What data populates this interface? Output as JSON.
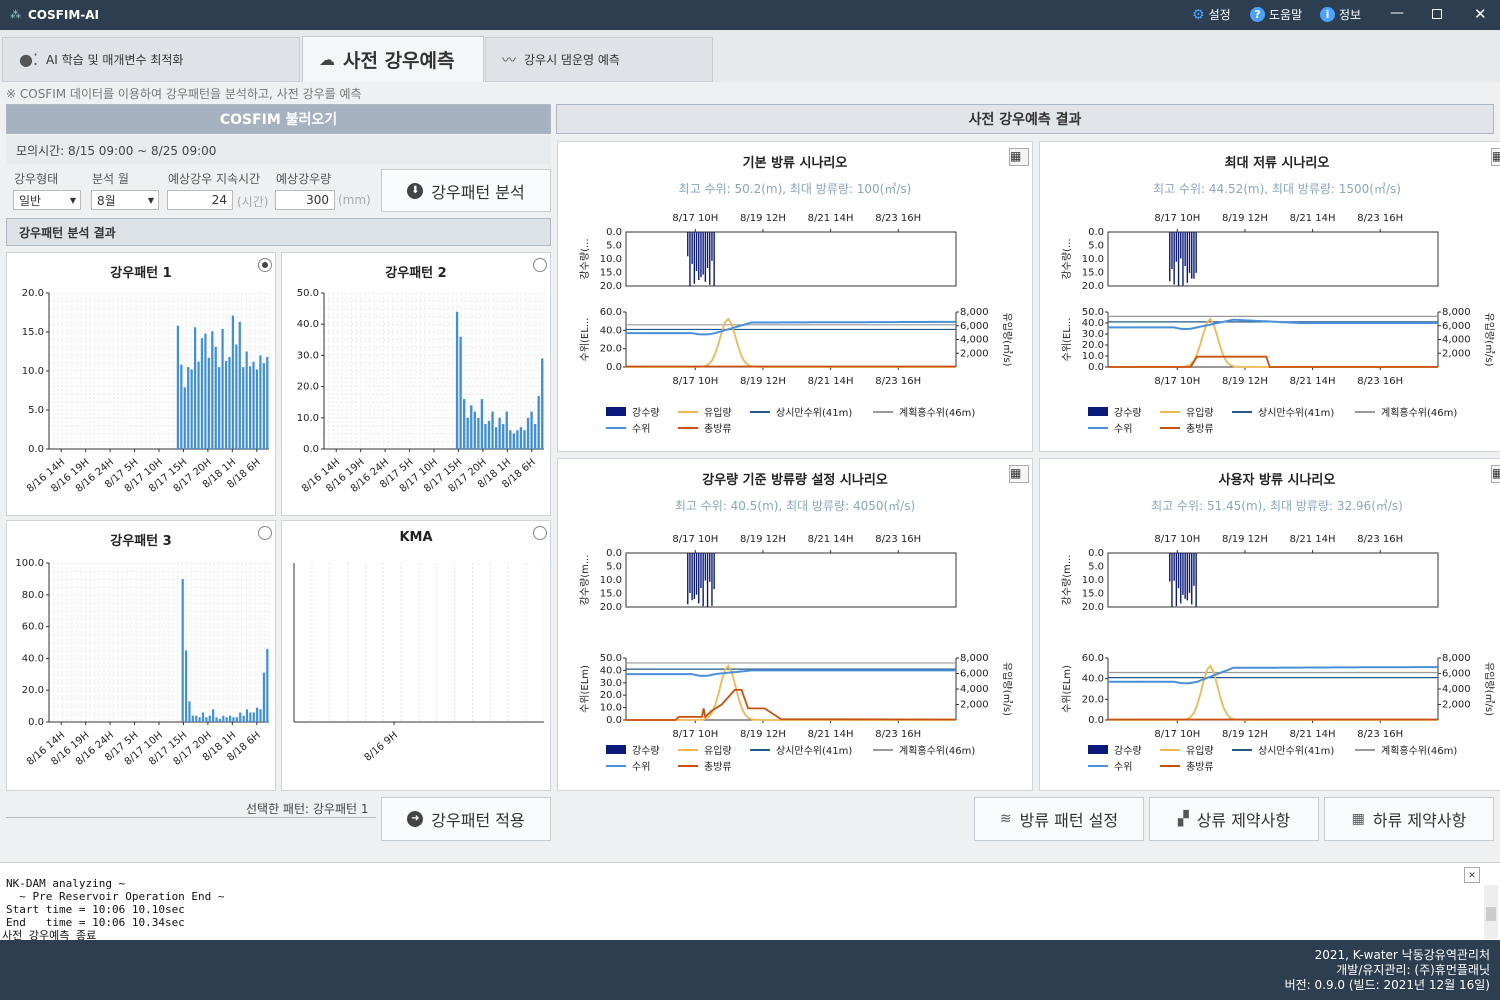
{
  "app": {
    "title": "COSFIM-AI",
    "menu": [
      "설정",
      "도움말",
      "정보"
    ]
  },
  "tabs": [
    {
      "label": "AI 학습 및 매개변수 최적화"
    },
    {
      "label": "사전 강우예측"
    },
    {
      "label": "강우시 댐운영 예측"
    }
  ],
  "notice": "※ COSFIM 데이터를 이용하여 강우패턴을 분석하고, 사전 강우를 예측",
  "left": {
    "load_title": "COSFIM 불러오기",
    "sim_time": "모의시간: 8/15 09:00 ~ 8/25 09:00",
    "labels": {
      "type": "강우형태",
      "month": "분석 월",
      "duration": "예상강우 지속시간",
      "amount": "예상강우량",
      "duration_unit": "(시간)",
      "amount_unit": "(mm)"
    },
    "values": {
      "type": "일반",
      "month": "8월",
      "duration": "24",
      "amount": "300"
    },
    "analyze_button": "강우패턴 분석",
    "result_title": "강우패턴 분석 결과",
    "selected": "선택한 패턴: 강우패턴 1",
    "apply_button": "강우패턴 적용"
  },
  "patterns": [
    {
      "title": "강우패턴 1",
      "selected": true,
      "yticks": [
        "0.0",
        "5.0",
        "10.0",
        "15.0",
        "20.0"
      ],
      "ymax": 20,
      "values": [
        0,
        0,
        0,
        0,
        0,
        0,
        0,
        0,
        0,
        0,
        0,
        0,
        0,
        0,
        0,
        0,
        0,
        0,
        0,
        0,
        0,
        0,
        0,
        0,
        0,
        0,
        0,
        0,
        0,
        0,
        0,
        0,
        0,
        0,
        0,
        0,
        0,
        15.8,
        10.8,
        7.9,
        10.5,
        10.2,
        15.6,
        11.2,
        14.2,
        14.8,
        11.7,
        15.1,
        13.1,
        10.5,
        15.4,
        11.3,
        11.8,
        17.1,
        13.4,
        16.3,
        10.5,
        12.5,
        10.6,
        11.2,
        10.2,
        12.0,
        11.0,
        11.8
      ]
    },
    {
      "title": "강우패턴 2",
      "selected": false,
      "yticks": [
        "0.0",
        "10.0",
        "20.0",
        "30.0",
        "40.0",
        "50.0"
      ],
      "ymax": 50,
      "values": [
        0,
        0,
        0,
        0,
        0,
        0,
        0,
        0,
        0,
        0,
        0,
        0,
        0,
        0,
        0,
        0,
        0,
        0,
        0,
        0,
        0,
        0,
        0,
        0,
        0,
        0,
        0,
        0,
        0,
        0,
        0,
        0,
        0,
        0,
        0,
        0,
        0,
        44,
        36,
        16,
        10,
        14,
        12,
        10,
        16,
        8,
        9,
        12,
        7,
        10,
        8,
        12,
        6,
        5,
        6,
        7,
        6,
        10,
        12,
        8,
        17,
        29
      ]
    },
    {
      "title": "강우패턴 3",
      "selected": false,
      "yticks": [
        "0.0",
        "20.0",
        "40.0",
        "60.0",
        "80.0",
        "100.0"
      ],
      "ymax": 100,
      "values": [
        0,
        0,
        0,
        0,
        0,
        0,
        0,
        0,
        0,
        0,
        0,
        0,
        0,
        0,
        0,
        0,
        0,
        0,
        0,
        0,
        0,
        0,
        0,
        0,
        0,
        0,
        0,
        0,
        0,
        0,
        0,
        0,
        0,
        0,
        0,
        0,
        0,
        0,
        0,
        90,
        45,
        13,
        4,
        4,
        3,
        6,
        3,
        4,
        8,
        3,
        2,
        4,
        3,
        4,
        3,
        3,
        6,
        4,
        8,
        6,
        6,
        9,
        8,
        31,
        46
      ]
    },
    {
      "title": "KMA",
      "selected": false,
      "yticks": [],
      "ymax": 1,
      "values": []
    }
  ],
  "xticks_pattern": [
    "8/16 14H",
    "8/16 19H",
    "8/16 24H",
    "8/17 5H",
    "8/17 10H",
    "8/17 15H",
    "8/17 20H",
    "8/18 1H",
    "8/18 6H"
  ],
  "xticks_kma": [
    "8/16 9H"
  ],
  "results": {
    "title": "사전 강우예측 결과",
    "xticks": [
      "8/17 10H",
      "8/19 12H",
      "8/21 14H",
      "8/23 16H"
    ],
    "rain_yticks": [
      "0.0",
      "5.0",
      "10.0",
      "15.0",
      "20.0"
    ],
    "q_yticks": [
      "2,000",
      "4,000",
      "6,000",
      "8,000"
    ],
    "legend": [
      "강수량",
      "유입량",
      "상시만수위(41m)",
      "계획홍수위(46m)",
      "수위",
      "총방류"
    ],
    "scenarios": [
      {
        "title": "기본 방류 시나리오",
        "subtitle": "최고 수위: 50.2(m), 최대 방류량: 100(㎥/s)",
        "rain_ylabel": "강수량(...",
        "wl_ylabel": "수위(EL...",
        "q_ylabel": "유입량(㎥/s)",
        "wl_yticks": [
          "0.0",
          "20.0",
          "40.0",
          "60.0"
        ],
        "wl_max": 60
      },
      {
        "title": "최대 저류 시나리오",
        "subtitle": "최고 수위: 44.52(m), 최대 방류량: 1500(㎥/s)",
        "rain_ylabel": "강수량(...",
        "wl_ylabel": "수위(EL...",
        "q_ylabel": "유입량(㎥/s)",
        "wl_yticks": [
          "0.0",
          "10.0",
          "20.0",
          "30.0",
          "40.0",
          "50.0"
        ],
        "wl_max": 50
      },
      {
        "title": "강우량 기준 방류량 설정 시나리오",
        "subtitle": "최고 수위: 40.5(m), 최대 방류량: 4050(㎥/s)",
        "rain_ylabel": "강수량(m...",
        "wl_ylabel": "수위(ELm)",
        "q_ylabel": "유입량(㎥/s)",
        "wl_yticks": [
          "0.0",
          "10.0",
          "20.0",
          "30.0",
          "40.0",
          "50.0"
        ],
        "wl_max": 50
      },
      {
        "title": "사용자 방류 시나리오",
        "subtitle": "최고 수위: 51.45(m), 최대 방류량: 32.96(㎥/s)",
        "rain_ylabel": "강수량(m...",
        "wl_ylabel": "수위(ELm)",
        "q_ylabel": "유입량(㎥/s)",
        "wl_yticks": [
          "0.0",
          "20.0",
          "40.0",
          "60.0"
        ],
        "wl_max": 60
      }
    ]
  },
  "bottom_buttons": [
    "방류 패턴 설정",
    "상류 제약사항",
    "하류 제약사항"
  ],
  "log": [
    "NK-DAM analyzing ~",
    "  ~ Pre Reservoir Operation End ~",
    "Start time = 10:06 10.10sec",
    "End   time = 10:06 10.34sec",
    "사전 강우예측 종료"
  ],
  "footer": [
    "2021, K-water 낙동강유역관리처",
    "개발/유지관리: (주)휴먼플래닛",
    "버전: 0.9.0 (빌드: 2021년 12월 16일)"
  ],
  "colors": {
    "rain": "#0a1a7a",
    "inflow": "#f0b850",
    "normal": "#1f5a8a",
    "flood": "#999999",
    "level": "#4a90d9",
    "outflow": "#c85010",
    "bar": "#3f8fe0"
  }
}
